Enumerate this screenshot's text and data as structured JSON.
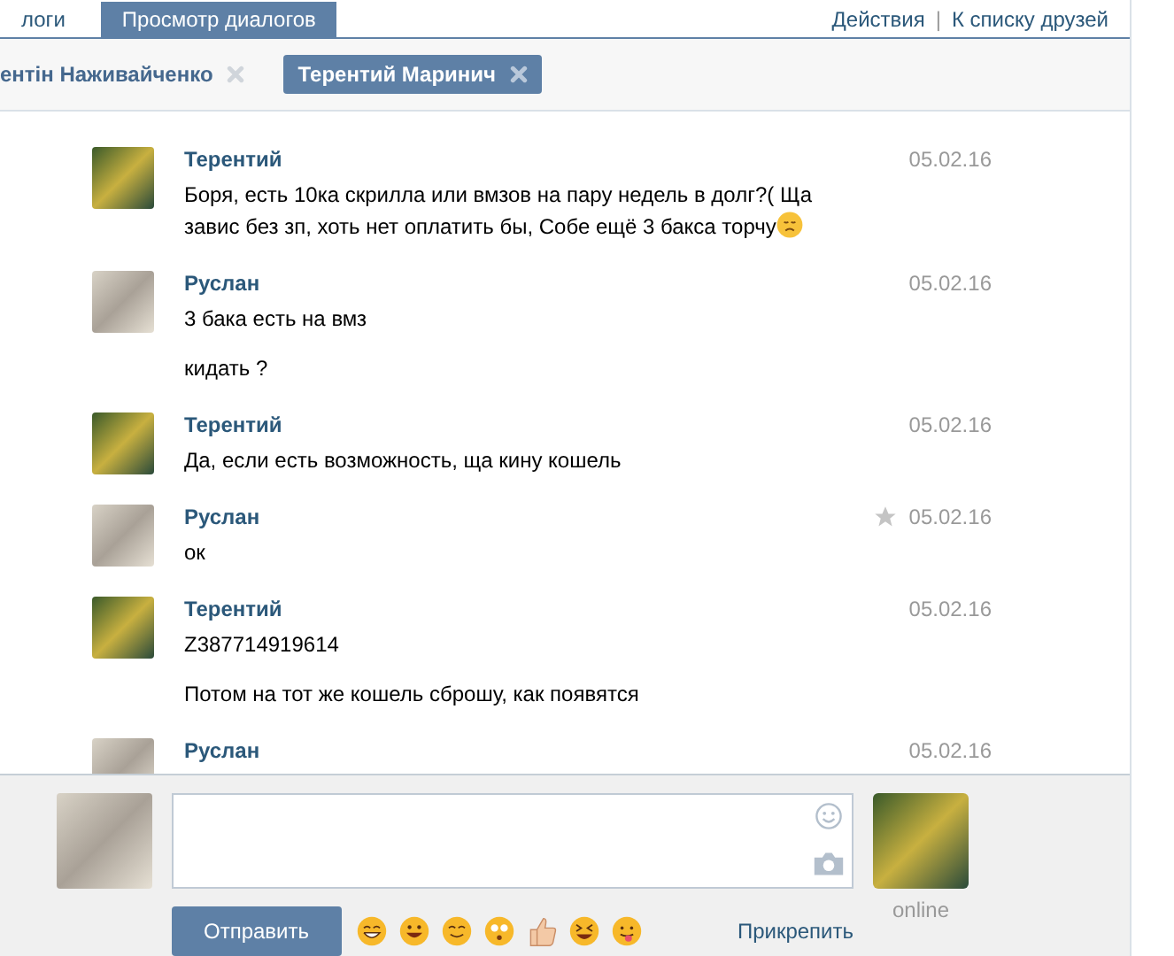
{
  "top_tabs": [
    {
      "label": "логи",
      "selected": false
    },
    {
      "label": "Просмотр диалогов",
      "selected": true
    }
  ],
  "top_links": [
    "Действия",
    "К списку друзей"
  ],
  "top_separator": "|",
  "dialog_tabs": [
    {
      "label": "ентін Наживайченко",
      "selected": false
    },
    {
      "label": "Терентий Маринич",
      "selected": true
    }
  ],
  "messages": [
    {
      "author": "Терентий",
      "kind": "peer",
      "date": "05.02.16",
      "hovered": false,
      "texts": [
        "Боря, есть 10ка скрилла или вмзов на пару недель в долг?( Ща завис без зп, хоть нет оплатить бы, Собе ещё 3 бакса торчу"
      ],
      "sad_emoji": true
    },
    {
      "author": "Руслан",
      "kind": "self",
      "date": "05.02.16",
      "hovered": false,
      "texts": [
        "3 бака есть на вмз",
        "кидать ?"
      ],
      "sad_emoji": false
    },
    {
      "author": "Терентий",
      "kind": "peer",
      "date": "05.02.16",
      "hovered": false,
      "texts": [
        "Да, если есть возможность, ща кину кошель"
      ],
      "sad_emoji": false
    },
    {
      "author": "Руслан",
      "kind": "self",
      "date": "05.02.16",
      "hovered": true,
      "texts": [
        "ок"
      ],
      "sad_emoji": false
    },
    {
      "author": "Терентий",
      "kind": "peer",
      "date": "05.02.16",
      "hovered": false,
      "texts": [
        "Z387714919614",
        "Потом на тот же кошель сброшу, как появятся"
      ],
      "sad_emoji": false
    },
    {
      "author": "Руслан",
      "kind": "self",
      "date": "05.02.16",
      "hovered": false,
      "sad_emoji": false
    }
  ],
  "composer": {
    "send_button": "Отправить",
    "attach_link": "Прикрепить",
    "status": "online",
    "emojis": [
      {
        "kind": "grin"
      },
      {
        "kind": "smile"
      },
      {
        "kind": "blush"
      },
      {
        "kind": "flushed"
      },
      {
        "kind": "thumbs"
      },
      {
        "kind": "laugh"
      },
      {
        "kind": "tongue"
      }
    ]
  }
}
